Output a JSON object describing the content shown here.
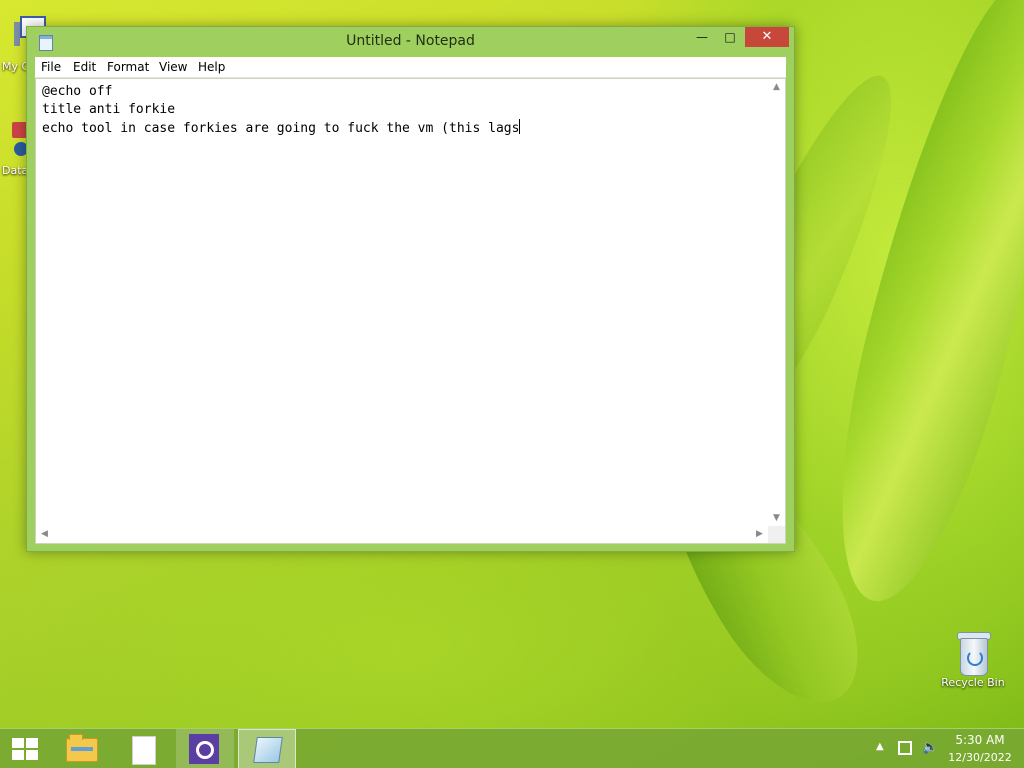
{
  "desktop": {
    "icons": [
      {
        "label": "My C"
      },
      {
        "label": "Data"
      },
      {
        "label": "Recycle Bin"
      }
    ]
  },
  "window": {
    "title": "Untitled - Notepad",
    "controls": {
      "minimize": "—",
      "maximize": "□",
      "close": "✕"
    },
    "menu": [
      "File",
      "Edit",
      "Format",
      "View",
      "Help"
    ],
    "content_lines": [
      "@echo off",
      "title anti forkie",
      "echo tool in case forkies are going to fuck the vm (this lags"
    ],
    "scroll": {
      "up": "▲",
      "down": "▼",
      "left": "◀",
      "right": "▶"
    }
  },
  "taskbar": {
    "pinned": [
      "file-explorer",
      "blank-document",
      "settings",
      "notepad"
    ],
    "tray_up_arrow": "▲",
    "volume_glyph": "🔈",
    "time": "5:30 AM",
    "date": "12/30/2022"
  }
}
